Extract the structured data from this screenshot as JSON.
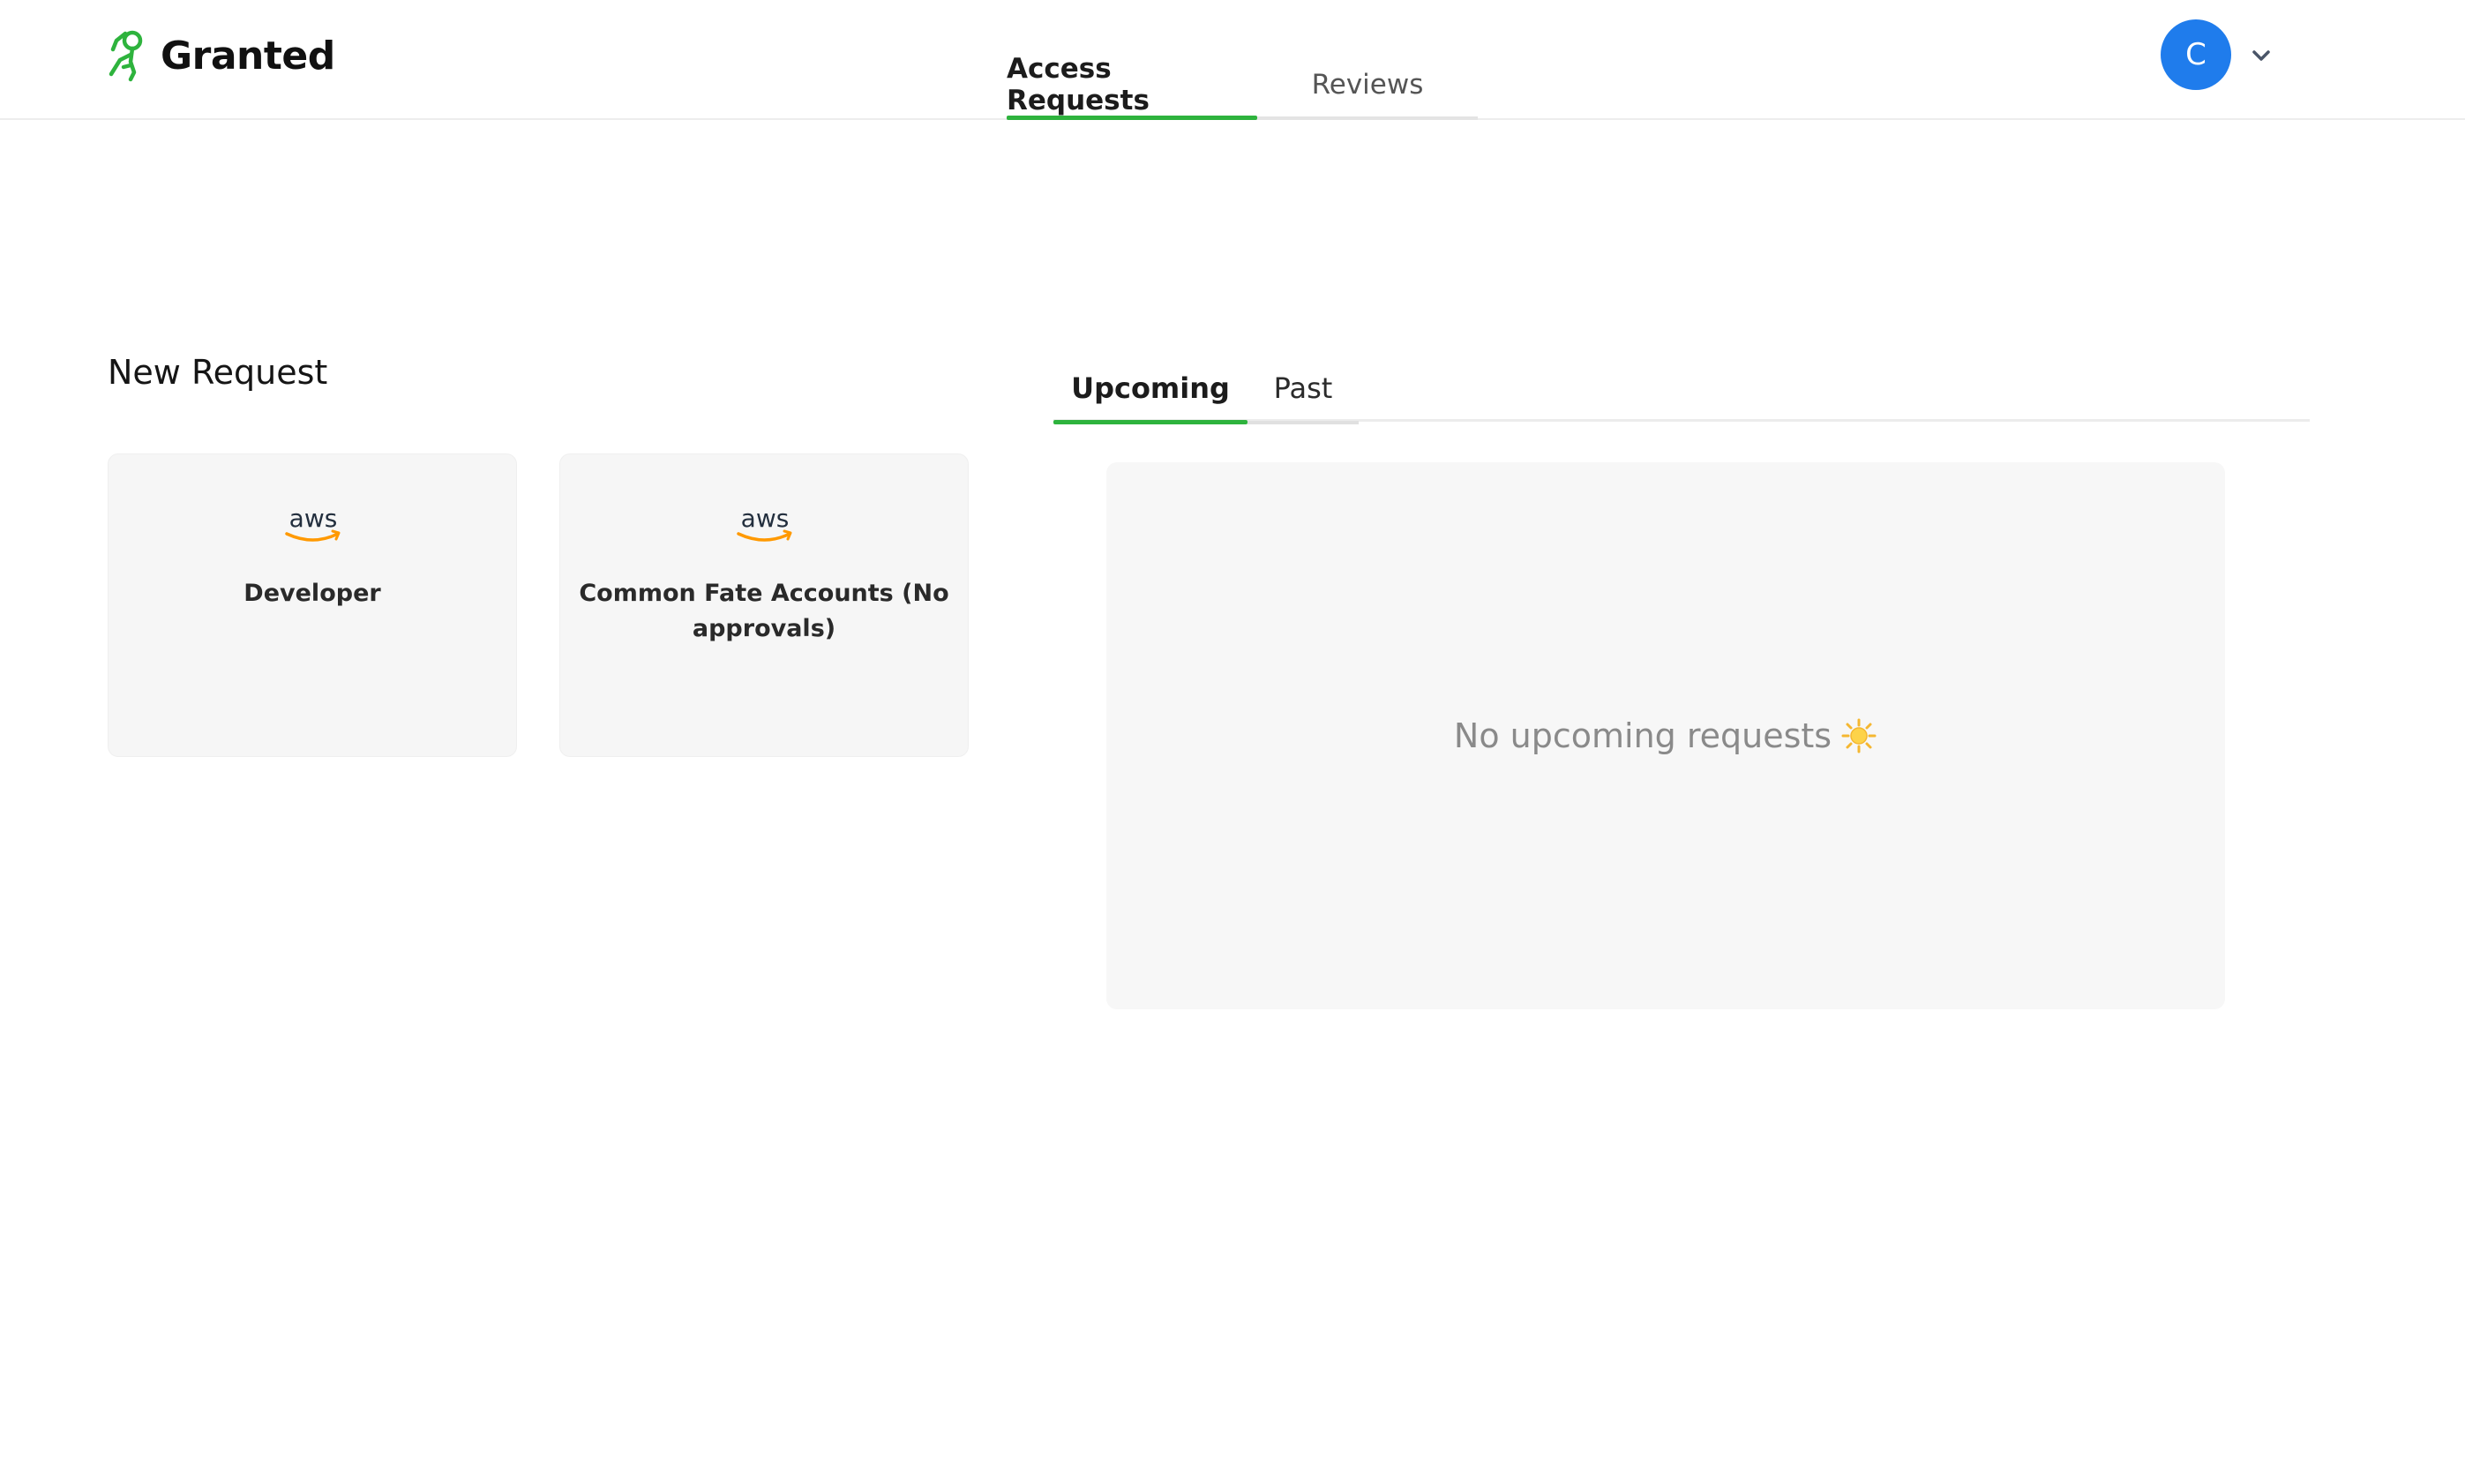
{
  "brand": {
    "name": "Granted",
    "accent": "#2eb33d"
  },
  "nav": {
    "tabs": [
      {
        "label": "Access Requests",
        "active": true
      },
      {
        "label": "Reviews",
        "active": false
      }
    ]
  },
  "user": {
    "initial": "C",
    "avatar_color": "#1f7cec"
  },
  "new_request": {
    "title": "New Request",
    "cards": [
      {
        "provider": "aws",
        "label": "Developer"
      },
      {
        "provider": "aws",
        "label": "Common Fate Accounts (No approvals)"
      }
    ]
  },
  "requests": {
    "tabs": [
      {
        "label": "Upcoming",
        "active": true
      },
      {
        "label": "Past",
        "active": false
      }
    ],
    "empty_message": "No upcoming requests",
    "empty_icon": "sun-icon"
  }
}
